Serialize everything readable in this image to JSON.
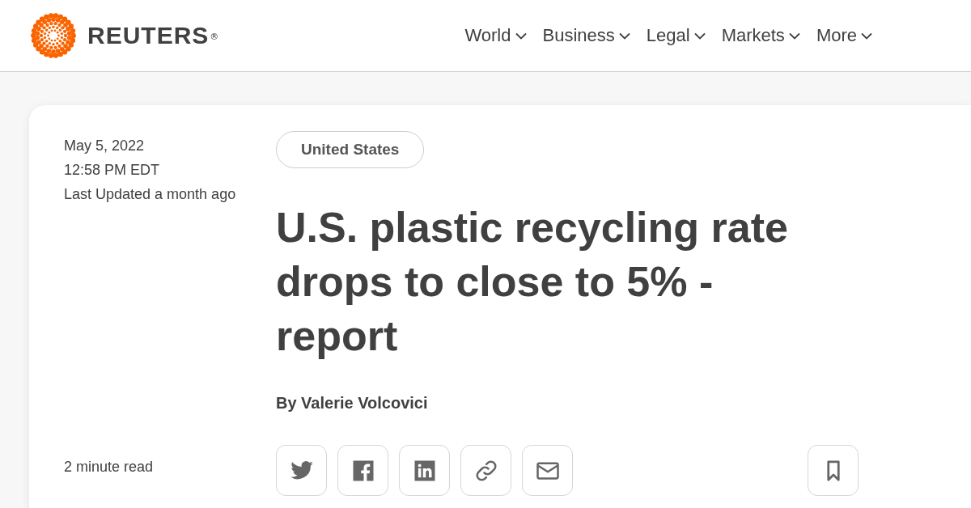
{
  "header": {
    "logo": {
      "text": "REUTERS",
      "mark": "®"
    },
    "nav": [
      {
        "label": "World"
      },
      {
        "label": "Business"
      },
      {
        "label": "Legal"
      },
      {
        "label": "Markets"
      },
      {
        "label": "More"
      }
    ]
  },
  "article": {
    "date": "May 5, 2022",
    "time": "12:58 PM EDT",
    "updated": "Last Updated a month ago",
    "read_time": "2 minute read",
    "tag": "United States",
    "headline": "U.S. plastic recycling rate drops to close to 5% - report",
    "byline": "By Valerie Volcovici",
    "share_buttons": [
      {
        "kind": "twitter"
      },
      {
        "kind": "facebook"
      },
      {
        "kind": "linkedin"
      },
      {
        "kind": "link"
      },
      {
        "kind": "email"
      }
    ],
    "bookmark": {
      "kind": "bookmark"
    }
  }
}
